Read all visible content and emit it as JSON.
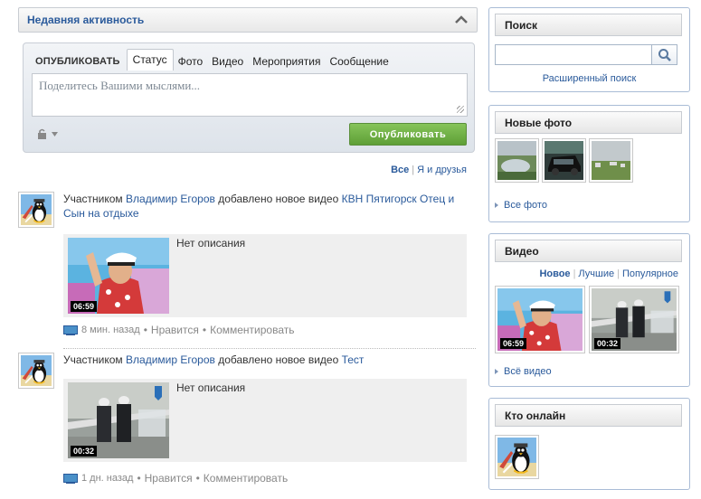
{
  "activity": {
    "title": "Недавняя активность"
  },
  "publisher": {
    "lead": "ОПУБЛИКОВАТЬ",
    "tabs": [
      "Статус",
      "Фото",
      "Видео",
      "Мероприятия",
      "Сообщение"
    ],
    "placeholder": "Поделитесь Вашими мыслями...",
    "button": "Опубликовать"
  },
  "filter": {
    "all": "Все",
    "me_and_friends": "Я и друзья"
  },
  "feed": [
    {
      "prefix": "Участником",
      "user": "Владимир Егоров",
      "action": "добавлено новое видео",
      "title": "КВН Пятигорск Отец и Сын на отдыхе",
      "duration": "06:59",
      "description": "Нет описания",
      "time": "8 мин. назад",
      "like": "Нравится",
      "comment": "Комментировать"
    },
    {
      "prefix": "Участником",
      "user": "Владимир Егоров",
      "action": "добавлено новое видео",
      "title": "Тест",
      "duration": "00:32",
      "description": "Нет описания",
      "time": "1 дн. назад",
      "like": "Нравится",
      "comment": "Комментировать"
    }
  ],
  "meta_separator": "•",
  "search": {
    "title": "Поиск",
    "advanced": "Расширенный поиск"
  },
  "photos": {
    "title": "Новые фото",
    "all": "Все фото"
  },
  "videos": {
    "title": "Видео",
    "tabs": [
      "Новое",
      "Лучшие",
      "Популярное"
    ],
    "durations": [
      "06:59",
      "00:32"
    ],
    "all": "Всё видео"
  },
  "online": {
    "title": "Кто онлайн"
  },
  "colors": {
    "link": "#2a5a9b",
    "publish_button": "#6aab3f",
    "widget_border": "#a9bcd6"
  }
}
